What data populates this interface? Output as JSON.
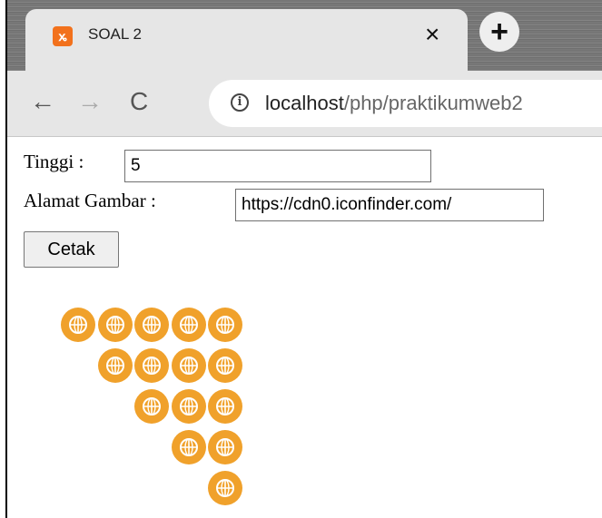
{
  "browser": {
    "tab": {
      "title": "SOAL 2",
      "favicon": "xampp-icon",
      "close": "×"
    },
    "new_tab": "+",
    "nav": {
      "back": "←",
      "forward": "→",
      "reload": "C"
    },
    "address": {
      "info": "i",
      "host": "localhost",
      "path": "/php/praktikumweb2"
    }
  },
  "form": {
    "height_label": "Tinggi :",
    "height_value": "5",
    "image_label": "Alamat Gambar :",
    "image_value": "https://cdn0.iconfinder.com/",
    "submit_label": "Cetak"
  },
  "output": {
    "rows": [
      5,
      4,
      3,
      2,
      1
    ],
    "icon": "globe-icon",
    "icon_color": "#f0a12b"
  },
  "colors": {
    "chrome_frame": "#6f6f6f",
    "toolbar": "#e6e6e6",
    "favicon": "#f2711c"
  }
}
